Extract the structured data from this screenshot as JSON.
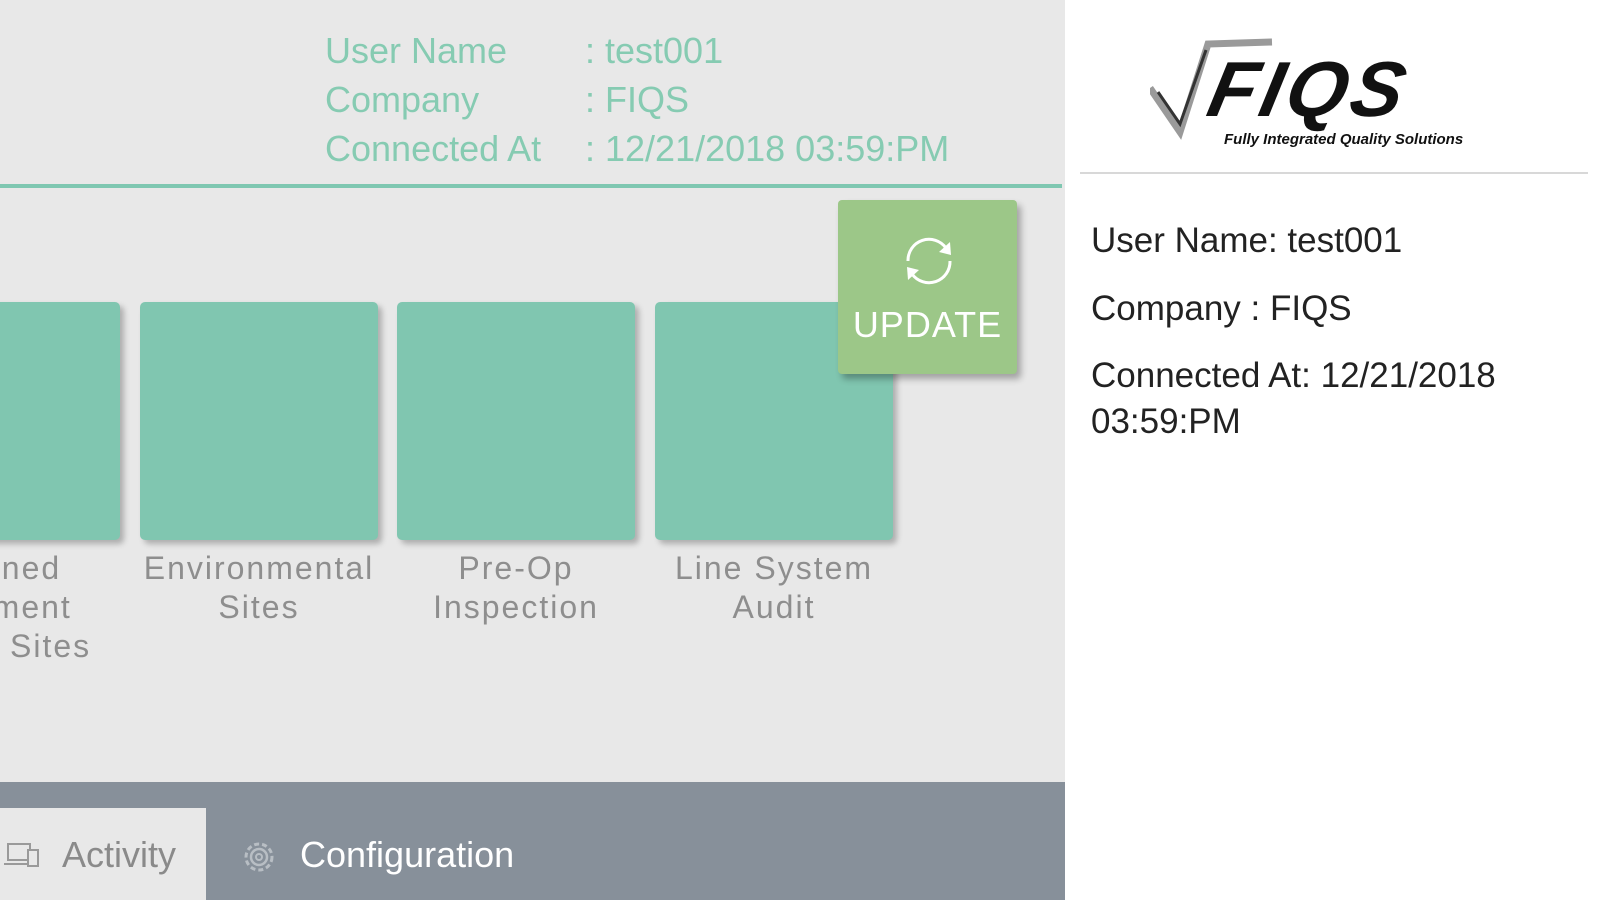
{
  "header": {
    "user_label": "User Name",
    "user_value": ": test001",
    "company_label": "Company",
    "company_value": ": FIQS",
    "connected_label": "Connected At",
    "connected_value": ": 12/21/2018 03:59:PM"
  },
  "tiles": [
    {
      "label_line1": "aned",
      "label_line2": "-ment",
      "label_line3": "Sites"
    },
    {
      "label_line1": "Environmental",
      "label_line2": "Sites"
    },
    {
      "label_line1": "Pre-Op",
      "label_line2": "Inspection"
    },
    {
      "label_line1": "Line System",
      "label_line2": "Audit"
    }
  ],
  "update_button": {
    "label": "UPDATE",
    "icon": "refresh-icon"
  },
  "bottom_tabs": [
    {
      "label": "Activity",
      "icon": "laptop-icon",
      "active": true
    },
    {
      "label": "Configuration",
      "icon": "gear-icon",
      "active": false
    }
  ],
  "sidebar": {
    "logo_text": "FIQS",
    "logo_tagline": "Fully Integrated Quality Solutions",
    "user_line": "User Name: test001",
    "company_line": "Company    : FIQS",
    "connected_line1": "Connected At: 12/21/2018",
    "connected_line2": "03:59:PM"
  },
  "colors": {
    "accent": "#80c6b0",
    "update_green": "#9cc788",
    "bar_gray": "#87909a",
    "header_text": "#86cbb2"
  }
}
